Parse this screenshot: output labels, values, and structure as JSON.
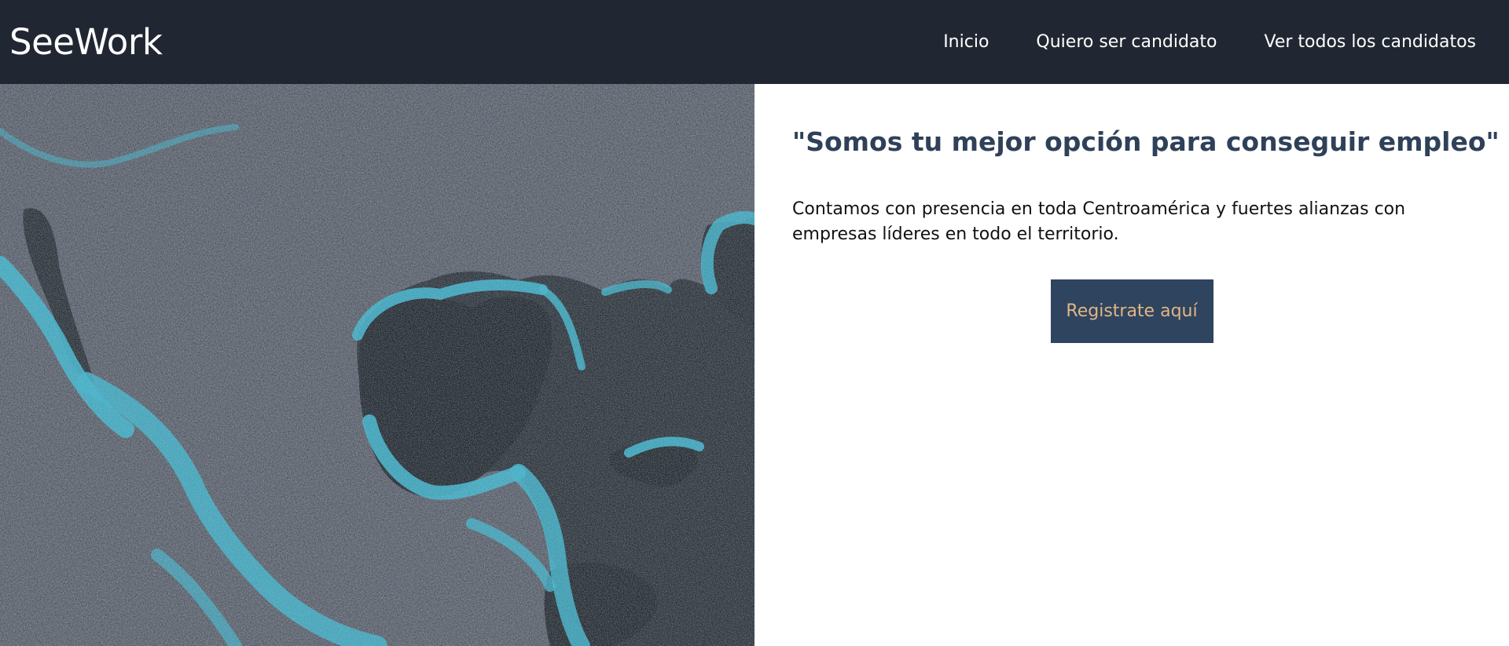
{
  "header": {
    "brand": "SeeWork",
    "nav": [
      {
        "label": "Inicio"
      },
      {
        "label": "Quiero ser candidato"
      },
      {
        "label": "Ver todos los candidatos"
      }
    ]
  },
  "hero": {
    "image_icon": "textured-world-map-image"
  },
  "main": {
    "headline": "\"Somos tu mejor opción para conseguir empleo\"",
    "description": "Contamos con presencia en toda Centroamérica y fuertes alianzas con empresas líderes en todo el territorio.",
    "cta_label": "Registrate aquí"
  },
  "colors": {
    "navbar": "#212732",
    "headline": "#2f4159",
    "button_bg": "#2f445f",
    "button_text": "#e1b584",
    "map_teal": "#36b3cc",
    "map_dark": "#1a2329"
  }
}
